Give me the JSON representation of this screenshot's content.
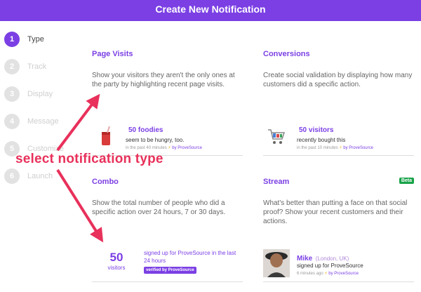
{
  "header": {
    "title": "Create New Notification"
  },
  "steps": [
    {
      "num": "1",
      "label": "Type"
    },
    {
      "num": "2",
      "label": "Track"
    },
    {
      "num": "3",
      "label": "Display"
    },
    {
      "num": "4",
      "label": "Message"
    },
    {
      "num": "5",
      "label": "Customize"
    },
    {
      "num": "6",
      "label": "Launch"
    }
  ],
  "cards": {
    "page_visits": {
      "title": "Page Visits",
      "desc": "Show your visitors they aren't the only ones at the party by highlighting recent page visits.",
      "headline": "50 foodies",
      "line": "seem to be hungry, too.",
      "meta": "in the past 40 minutes",
      "by": "by ProveSource"
    },
    "conversions": {
      "title": "Conversions",
      "desc": "Create social validation by displaying how many customers did a specific action.",
      "headline": "50 visitors",
      "line": "recently bought this",
      "meta": "in the past 10 minutes",
      "by": "by ProveSource"
    },
    "combo": {
      "title": "Combo",
      "desc": "Show the total number of people who did a specific action over 24 hours, 7 or 30 days.",
      "count": "50",
      "unit": "visitors",
      "line": "signed up for ProveSource in the last 24 hours",
      "verified": "verified by ProveSource"
    },
    "stream": {
      "title": "Stream",
      "badge": "Beta",
      "desc": "What's better than putting a face on that social proof? Show your recent customers and their actions.",
      "name": "Mike",
      "location": "(London, UK)",
      "line": "signed up for ProveSource",
      "meta": "6 minutes ago",
      "by": "by ProveSource"
    }
  },
  "annotation": {
    "text": "select notification type"
  },
  "colors": {
    "accent": "#7b3fe4",
    "annotation": "#e8315b",
    "badge": "#1aa34a",
    "bolt": "#f0a500"
  }
}
